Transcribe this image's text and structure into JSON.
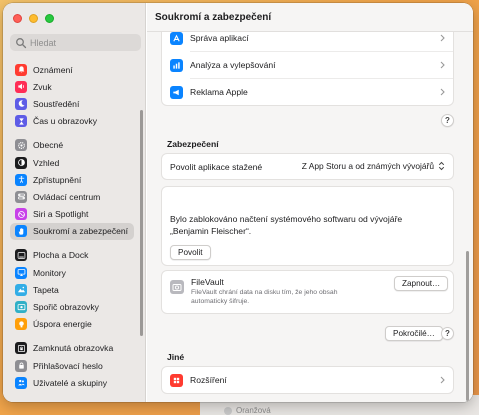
{
  "window": {
    "title": "Soukromí a zabezpečení"
  },
  "search": {
    "placeholder": "Hledat"
  },
  "sidebar": {
    "groups": [
      [
        {
          "label": "Oznámení",
          "icon": "bell-icon",
          "color": "#ff3b30"
        },
        {
          "label": "Zvuk",
          "icon": "speaker-icon",
          "color": "#ff2d55"
        },
        {
          "label": "Soustředění",
          "icon": "moon-icon",
          "color": "#5e5ce6"
        },
        {
          "label": "Čas u obrazovky",
          "icon": "hourglass-icon",
          "color": "#5e5ce6"
        }
      ],
      [
        {
          "label": "Obecné",
          "icon": "gear-icon",
          "color": "#8e8e93"
        },
        {
          "label": "Vzhled",
          "icon": "appearance-icon",
          "color": "#1c1c1e"
        },
        {
          "label": "Zpřístupnění",
          "icon": "accessibility-icon",
          "color": "#0a84ff"
        },
        {
          "label": "Ovládací centrum",
          "icon": "control-center-icon",
          "color": "#8e8e93"
        },
        {
          "label": "Siri a Spotlight",
          "icon": "siri-icon",
          "color": "#c840e9"
        },
        {
          "label": "Soukromí a zabezpečení",
          "icon": "hand-icon",
          "color": "#0a84ff",
          "selected": true
        }
      ],
      [
        {
          "label": "Plocha a Dock",
          "icon": "dock-icon",
          "color": "#1c1c1e"
        },
        {
          "label": "Monitory",
          "icon": "display-icon",
          "color": "#0a84ff"
        },
        {
          "label": "Tapeta",
          "icon": "wallpaper-icon",
          "color": "#32ade6"
        },
        {
          "label": "Spořič obrazovky",
          "icon": "screensaver-icon",
          "color": "#30b0c7"
        },
        {
          "label": "Úspora energie",
          "icon": "bulb-icon",
          "color": "#ff9f0a"
        }
      ],
      [
        {
          "label": "Zamknutá obrazovka",
          "icon": "lock-screen-icon",
          "color": "#1c1c1e"
        },
        {
          "label": "Přihlašovací heslo",
          "icon": "lock-icon",
          "color": "#8e8e93"
        },
        {
          "label": "Uživatelé a skupiny",
          "icon": "users-icon",
          "color": "#0a84ff"
        }
      ]
    ]
  },
  "main": {
    "top_card": {
      "rows": [
        {
          "label": "Správa aplikací",
          "icon": "app-management-icon",
          "color": "#0a84ff"
        },
        {
          "label": "Analýza a vylepšování",
          "icon": "analytics-icon",
          "color": "#0a84ff"
        },
        {
          "label": "Reklama Apple",
          "icon": "megaphone-icon",
          "color": "#0a84ff"
        }
      ]
    },
    "help_label": "?",
    "security": {
      "title": "Zabezpečení",
      "allow_label": "Povolit aplikace stažené",
      "allow_value": "Z App Storu a od známých vývojářů",
      "blocked_message": "Bylo zablokováno načtení systémového softwaru od vývojáře „Benjamin Fleischer“.",
      "allow_button": "Povolit"
    },
    "filevault": {
      "title": "FileVault",
      "description": "FileVault chrání data na disku tím, že jeho obsah automaticky šifruje.",
      "button": "Zapnout…"
    },
    "advanced_button": "Pokročilé…",
    "other": {
      "title": "Jiné",
      "rows": [
        {
          "label": "Rozšíření",
          "icon": "extensions-icon",
          "color": "#ff3b30"
        }
      ]
    }
  },
  "backdrop": {
    "peek_text": "Oranžová"
  }
}
